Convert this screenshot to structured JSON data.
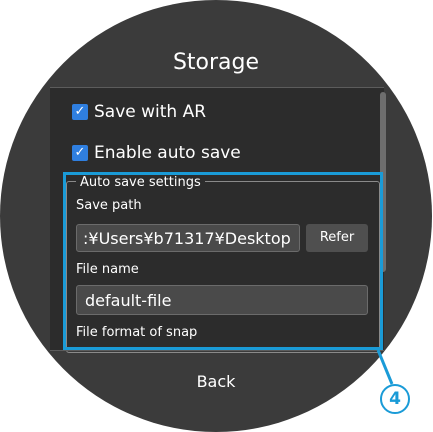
{
  "screen": {
    "title": "Storage",
    "back_label": "Back"
  },
  "options": {
    "save_with_ar": {
      "label": "Save with AR",
      "checked": true
    },
    "enable_auto_save": {
      "label": "Enable auto save",
      "checked": true
    }
  },
  "auto_save_settings": {
    "legend": "Auto save settings",
    "save_path": {
      "label": "Save path",
      "value": ":\\Users\\b71317\\Desktop",
      "display": ":¥Users¥b71317¥Desktop"
    },
    "refer_label": "Refer",
    "file_name": {
      "label": "File name",
      "value": "default-file"
    },
    "file_format_label": "File format of snap"
  },
  "annotation": {
    "marker": "4",
    "color": "#1a9bd7"
  },
  "colors": {
    "accent": "#2f7fe0",
    "background": "#3b3b3b"
  }
}
